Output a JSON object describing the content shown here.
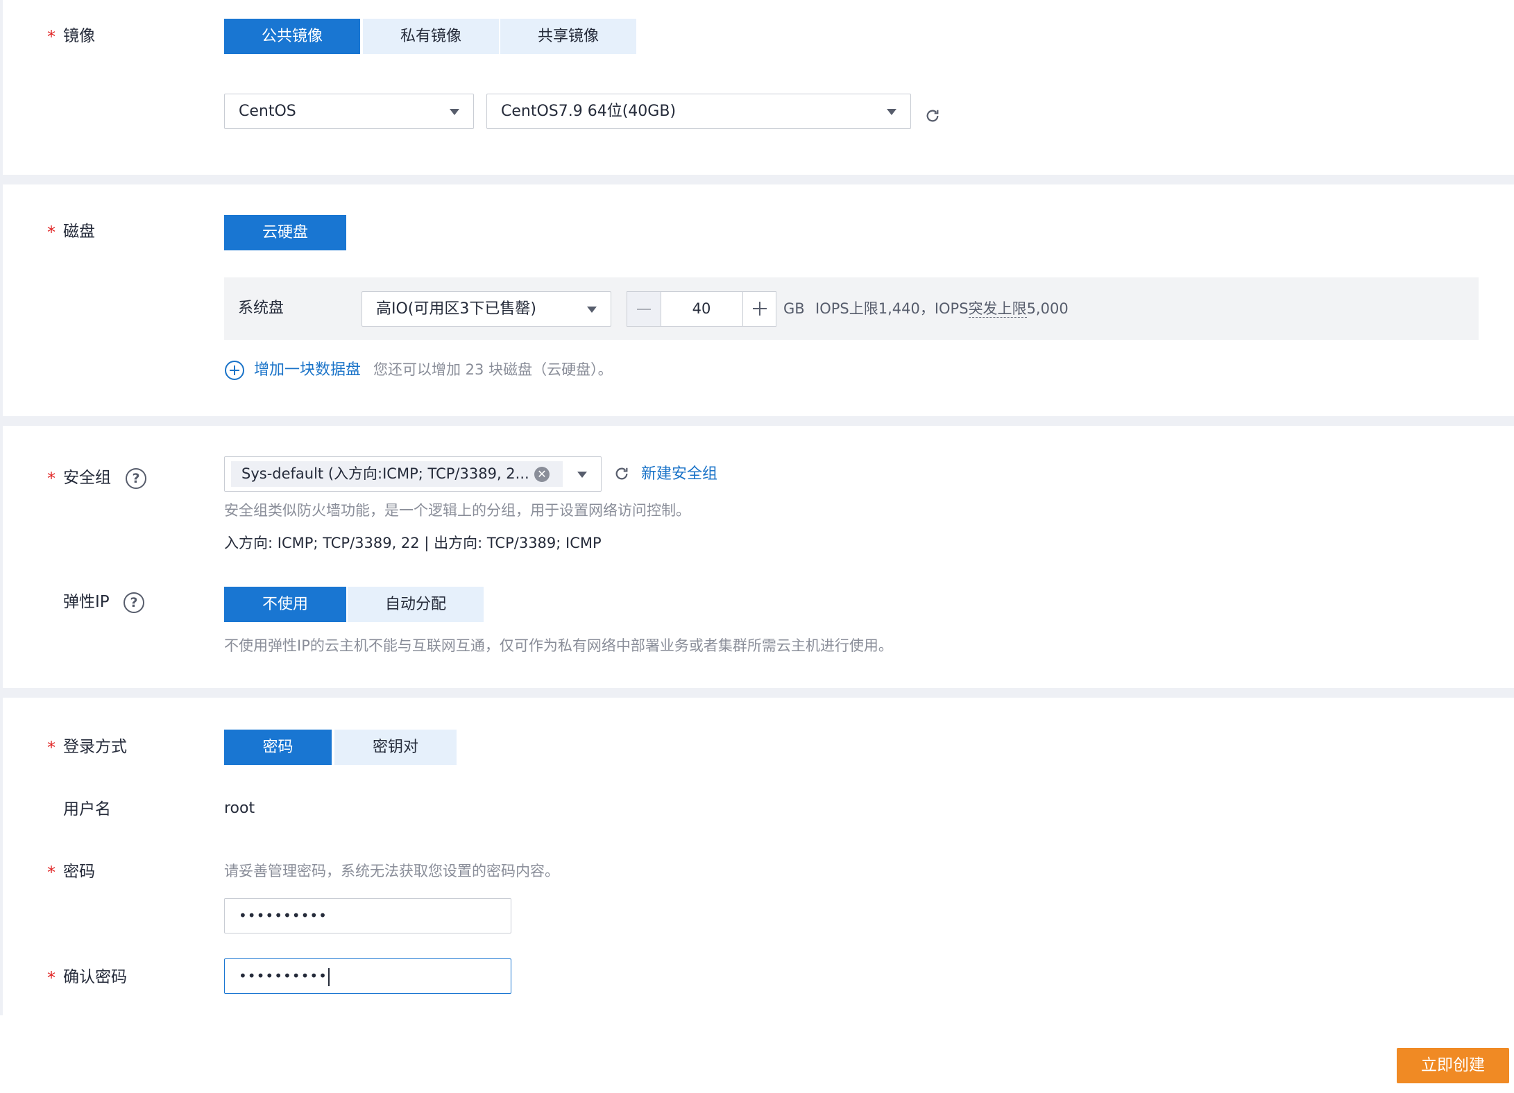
{
  "image": {
    "label": "镜像",
    "tabs": [
      "公共镜像",
      "私有镜像",
      "共享镜像"
    ],
    "os_type": "CentOS",
    "os_version": "CentOS7.9 64位(40GB)"
  },
  "disk": {
    "label": "磁盘",
    "type_button": "云硬盘",
    "system_disk_label": "系统盘",
    "disk_type": "高IO(可用区3下已售罄)",
    "size": "40",
    "unit": "GB",
    "iops_prefix": "IOPS上限1,440，IOPS",
    "iops_burst": "突发上限",
    "iops_value": "5,000",
    "add_link": "增加一块数据盘",
    "add_hint": "您还可以增加 23 块磁盘（云硬盘）。"
  },
  "security": {
    "label": "安全组",
    "selected_tag": "Sys-default (入方向:ICMP; TCP/3389, 2...",
    "new_link": "新建安全组",
    "hint": "安全组类似防火墙功能，是一个逻辑上的分组，用于设置网络访问控制。",
    "rules": "入方向: ICMP; TCP/3389, 22 | 出方向: TCP/3389; ICMP",
    "eip_label": "弹性IP",
    "eip_tabs": [
      "不使用",
      "自动分配"
    ],
    "eip_hint": "不使用弹性IP的云主机不能与互联网互通，仅可作为私有网络中部署业务或者集群所需云主机进行使用。"
  },
  "login": {
    "label": "登录方式",
    "tabs": [
      "密码",
      "密钥对"
    ],
    "username_label": "用户名",
    "username": "root",
    "password_label": "密码",
    "password_hint": "请妥善管理密码，系统无法获取您设置的密码内容。",
    "password_value": "••••••••••",
    "confirm_label": "确认密码",
    "confirm_value": "••••••••••"
  },
  "footer": {
    "create_button": "立即创建",
    "create_color": "#f08a24"
  },
  "colors": {
    "primary": "#1976d2",
    "required": "#e02424",
    "link": "#1a73c8"
  }
}
